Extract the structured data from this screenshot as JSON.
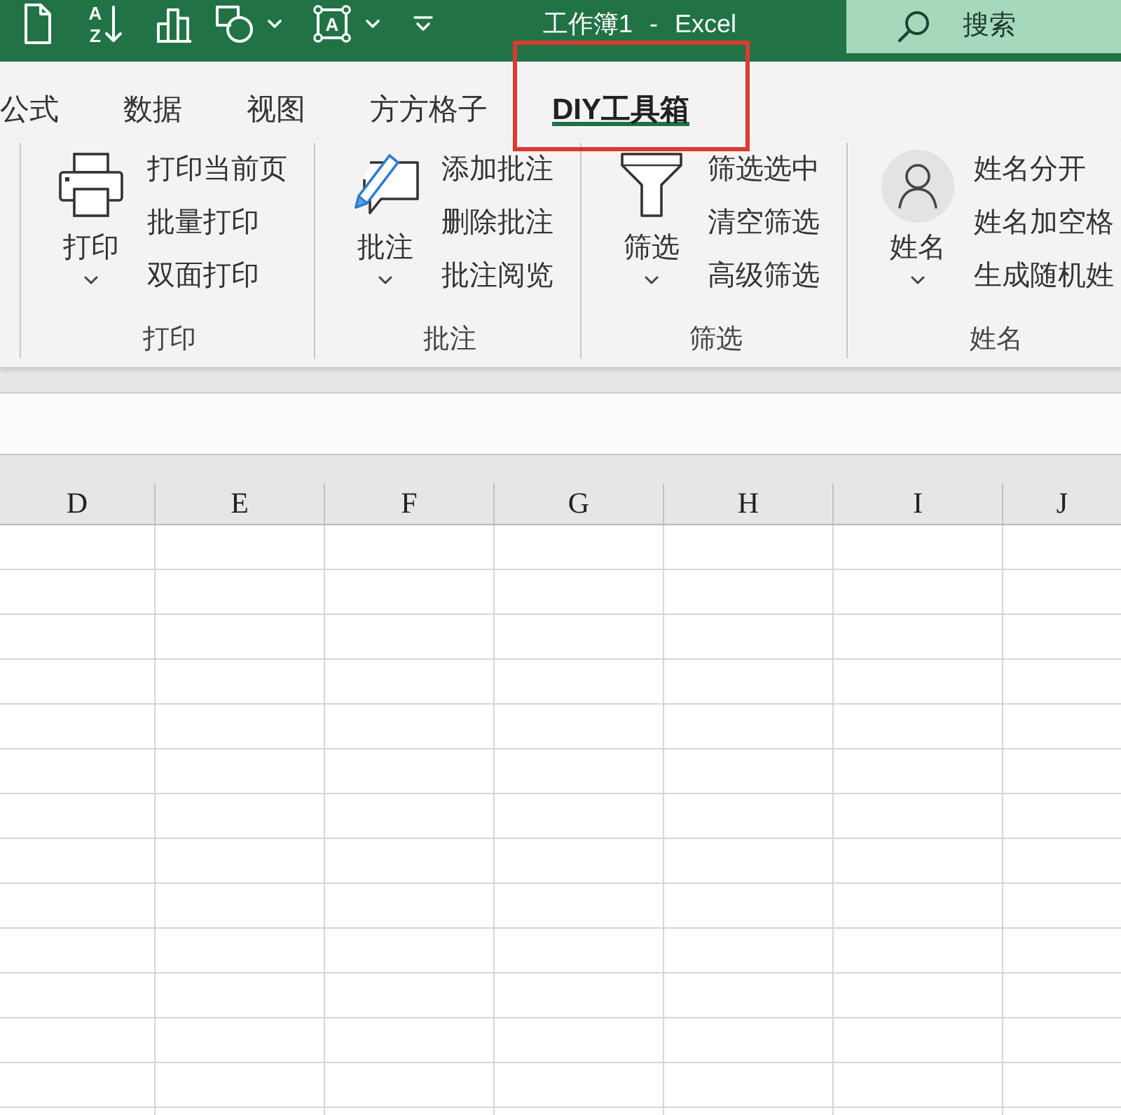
{
  "title_bar": {
    "quick_access": {
      "sort_letters": [
        "A",
        "Z"
      ],
      "text_box_letter": "A"
    },
    "title": "工作簿1 - Excel",
    "search": {
      "placeholder": "搜索"
    }
  },
  "tabs": [
    {
      "label": "公式",
      "selected": false
    },
    {
      "label": "数据",
      "selected": false
    },
    {
      "label": "视图",
      "selected": false
    },
    {
      "label": "方方格子",
      "selected": false
    },
    {
      "label": "DIY工具箱",
      "selected": true
    }
  ],
  "ribbon_groups": [
    {
      "label": "打印",
      "button": "打印",
      "commands": [
        "打印当前页",
        "批量打印",
        "双面打印"
      ]
    },
    {
      "label": "批注",
      "button": "批注",
      "commands": [
        "添加批注",
        "删除批注",
        "批注阅览"
      ]
    },
    {
      "label": "筛选",
      "button": "筛选",
      "commands": [
        "筛选选中",
        "清空筛选",
        "高级筛选"
      ]
    },
    {
      "label": "姓名",
      "button": "姓名",
      "commands": [
        "姓名分开",
        "姓名加空格",
        "生成随机姓"
      ]
    }
  ],
  "columns": [
    "D",
    "E",
    "F",
    "G",
    "H",
    "I",
    "J"
  ]
}
